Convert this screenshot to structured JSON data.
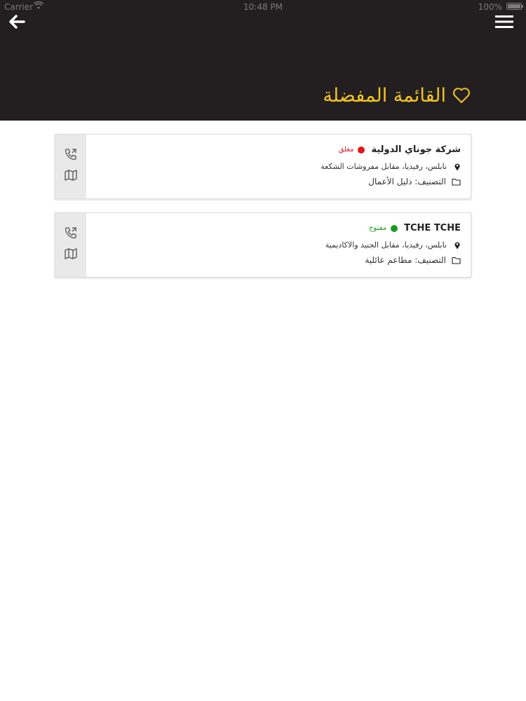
{
  "status_bar": {
    "carrier": "Carrier",
    "time": "10:48 PM",
    "battery": "100%"
  },
  "header": {
    "title": "القائمة المفضلة",
    "title_color": "#f4c51f",
    "background": "#231f20",
    "back_icon": "arrow-left-icon",
    "menu_icon": "hamburger-menu-icon",
    "title_icon": "heart-outline-icon"
  },
  "favorites": [
    {
      "name": "شركة جوناي الدولية",
      "status": "مغلق",
      "status_color": "#e0161c",
      "address": "نابلس، رفيديا، مقابل مفروشات الشكعة",
      "category": "التصنيف: دليل الأعمال",
      "actions": [
        "phone-icon",
        "map-icon"
      ]
    },
    {
      "name": "TCHE TCHE",
      "status": "مفتوح",
      "status_color": "#1c9a1c",
      "address": "نابلس، رفيديا، مقابل الجنيد والاكاديمية",
      "category": "التصنيف: مطاعم عائلية",
      "actions": [
        "phone-icon",
        "map-icon"
      ]
    }
  ]
}
